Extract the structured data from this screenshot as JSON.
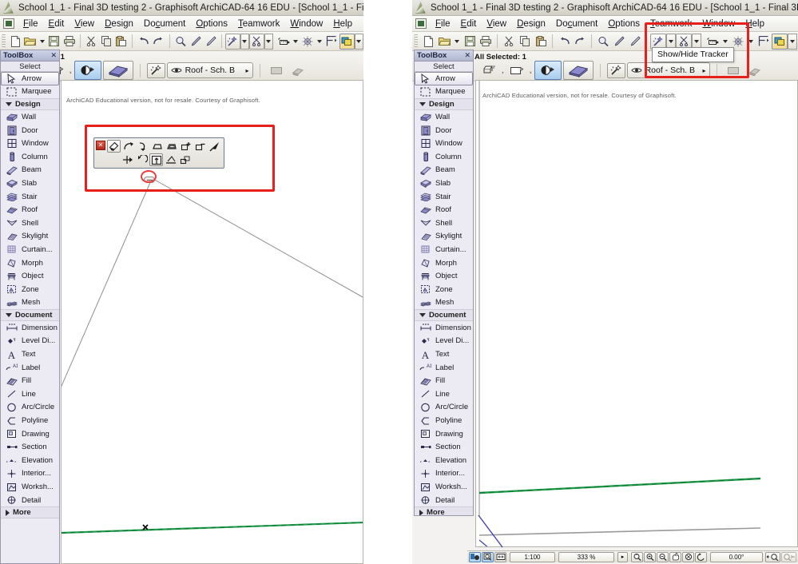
{
  "app": {
    "title": "School 1_1 - Final 3D testing 2 - Graphisoft ArchiCAD-64 16 EDU - [School 1_1 - Final 3D",
    "logo_icon": "archicad-logo-icon"
  },
  "menubar": {
    "items": [
      {
        "label": "File"
      },
      {
        "label": "Edit"
      },
      {
        "label": "View"
      },
      {
        "label": "Design"
      },
      {
        "label": "Document"
      },
      {
        "label": "Options"
      },
      {
        "label": "Teamwork"
      },
      {
        "label": "Window"
      },
      {
        "label": "Help"
      }
    ]
  },
  "toolbar": {
    "buttons": [
      {
        "name": "new-document-icon",
        "tip": "New"
      },
      {
        "name": "open-folder-icon",
        "tip": "Open"
      },
      {
        "name": "open-dropdown-caret-icon",
        "tip": "Open options"
      },
      {
        "name": "save-icon",
        "tip": "Save"
      },
      {
        "name": "print-icon",
        "tip": "Print"
      },
      {
        "name": "cut-scissors-icon",
        "tip": "Cut"
      },
      {
        "name": "copy-icon",
        "tip": "Copy"
      },
      {
        "name": "paste-icon",
        "tip": "Paste"
      },
      {
        "name": "undo-icon",
        "tip": "Undo"
      },
      {
        "name": "redo-icon",
        "tip": "Redo"
      },
      {
        "name": "find-select-icon",
        "tip": "Find & Select"
      },
      {
        "name": "pencil-icon",
        "tip": "Pencil"
      },
      {
        "name": "pencil-alt-icon",
        "tip": "Pencil"
      },
      {
        "name": "magic-wand-icon",
        "tip": "Magic Wand"
      },
      {
        "name": "magic-wand-caret-icon",
        "tip": "Magic Wand options"
      },
      {
        "name": "trim-icon",
        "tip": "Trim"
      },
      {
        "name": "trim-caret-icon",
        "tip": "Trim options"
      },
      {
        "name": "measure-icon",
        "tip": "Measure"
      },
      {
        "name": "measure-caret-icon",
        "tip": "Measure options"
      },
      {
        "name": "grid-snap-icon",
        "tip": "Grid Snap"
      },
      {
        "name": "grid-snap-caret-icon",
        "tip": "Grid Snap options"
      },
      {
        "name": "guide-lines-icon",
        "tip": "Guide Lines"
      },
      {
        "name": "show-hide-tracker-icon",
        "tip": "Show/Hide Tracker"
      },
      {
        "name": "tracker-caret-icon",
        "tip": "Tracker options"
      }
    ]
  },
  "infobar": {
    "close_label": "✕",
    "selected_text": "All Selected: 1",
    "buttons": [
      {
        "name": "settings-dialog-icon"
      },
      {
        "name": "favorites-icon"
      },
      {
        "name": "pen-color-icon"
      },
      {
        "name": "element-preview-icon"
      }
    ],
    "separator_1": ",",
    "separator_2": ",",
    "magic_wand_icon": "magic-wand-icon",
    "layer_combo": {
      "icon": "eye-icon",
      "value": "Roof - Sch. B",
      "arrow": "▸"
    }
  },
  "toolbox": {
    "title": "ToolBox",
    "close_label": "✕",
    "select_header": "Select",
    "groups": [
      {
        "name": "select",
        "kind": "plain",
        "items": [
          {
            "label": "Arrow",
            "icon": "arrow-cursor-icon",
            "selected": true
          },
          {
            "label": "Marquee",
            "icon": "marquee-icon",
            "selected": false
          }
        ]
      },
      {
        "name": "design",
        "kind": "collapsible",
        "label": "Design",
        "expanded": true,
        "items": [
          {
            "label": "Wall",
            "icon": "wall-icon"
          },
          {
            "label": "Door",
            "icon": "door-icon"
          },
          {
            "label": "Window",
            "icon": "window-icon"
          },
          {
            "label": "Column",
            "icon": "column-icon"
          },
          {
            "label": "Beam",
            "icon": "beam-icon"
          },
          {
            "label": "Slab",
            "icon": "slab-icon"
          },
          {
            "label": "Stair",
            "icon": "stair-icon"
          },
          {
            "label": "Roof",
            "icon": "roof-icon"
          },
          {
            "label": "Shell",
            "icon": "shell-icon"
          },
          {
            "label": "Skylight",
            "icon": "skylight-icon"
          },
          {
            "label": "Curtain...",
            "icon": "curtain-wall-icon"
          },
          {
            "label": "Morph",
            "icon": "morph-icon"
          },
          {
            "label": "Object",
            "icon": "object-icon"
          },
          {
            "label": "Zone",
            "icon": "zone-icon"
          },
          {
            "label": "Mesh",
            "icon": "mesh-icon"
          }
        ]
      },
      {
        "name": "document",
        "kind": "collapsible",
        "label": "Document",
        "expanded": true,
        "items": [
          {
            "label": "Dimension",
            "icon": "dimension-icon"
          },
          {
            "label": "Level Di...",
            "icon": "level-dimension-icon"
          },
          {
            "label": "Text",
            "icon": "text-icon"
          },
          {
            "label": "Label",
            "icon": "label-icon"
          },
          {
            "label": "Fill",
            "icon": "fill-icon"
          },
          {
            "label": "Line",
            "icon": "line-icon"
          },
          {
            "label": "Arc/Circle",
            "icon": "arc-circle-icon"
          },
          {
            "label": "Polyline",
            "icon": "polyline-icon"
          },
          {
            "label": "Drawing",
            "icon": "drawing-icon"
          },
          {
            "label": "Section",
            "icon": "section-icon"
          },
          {
            "label": "Elevation",
            "icon": "elevation-icon"
          },
          {
            "label": "Interior...",
            "icon": "interior-elevation-icon"
          },
          {
            "label": "Worksh...",
            "icon": "worksheet-icon"
          },
          {
            "label": "Detail",
            "icon": "detail-icon"
          }
        ]
      },
      {
        "name": "more",
        "kind": "collapsible",
        "label": "More",
        "expanded": false,
        "items": []
      }
    ]
  },
  "canvas": {
    "watermark": "ArchiCAD Educational version, not for resale. Courtesy of Graphisoft.",
    "colors": {
      "green_line": "#1f9e4a",
      "gray_line": "#8e8e8e",
      "blue_line": "#3b3bb0",
      "marker": "#000000"
    }
  },
  "pet_palette": {
    "close_label": "✕",
    "row1": [
      {
        "name": "pet-edit-polygon-icon",
        "active": true
      },
      {
        "name": "pet-curve-edge-icon",
        "active": false
      },
      {
        "name": "pet-curve-tangent-icon",
        "active": false
      },
      {
        "name": "pet-offset-edge-icon",
        "active": false
      },
      {
        "name": "pet-offset-all-edges-icon",
        "active": false
      },
      {
        "name": "pet-add-to-polygon-icon",
        "active": false
      },
      {
        "name": "pet-subtract-from-polygon-icon",
        "active": false
      },
      {
        "name": "pet-insert-node-icon",
        "active": false
      }
    ],
    "row2": [
      {
        "name": "pet-drag-icon",
        "active": false
      },
      {
        "name": "pet-rotate-icon",
        "active": false
      },
      {
        "name": "pet-elevate-icon",
        "active": true
      },
      {
        "name": "pet-pivot-line-icon",
        "active": false
      },
      {
        "name": "pet-multiply-icon",
        "active": false
      }
    ],
    "handle_name": "pet-palette-drag-handle"
  },
  "annotations": {
    "left_redbox_name": "pet-palette-highlight-box",
    "left_redellipse_name": "pet-handle-highlight-ellipse",
    "right_redbox_name": "tracker-button-highlight-box"
  },
  "tooltip": {
    "text": "Show/Hide Tracker"
  },
  "statusbar": {
    "buttons": [
      {
        "name": "3d-view-icon",
        "active": true
      },
      {
        "name": "zoom-selection-icon",
        "active": true
      },
      {
        "name": "fit-in-window-icon",
        "active": false
      }
    ],
    "scale_value": "1:100",
    "zoom_value": "333 %",
    "orientation_value": "0.00°",
    "play_arrow": "▸",
    "nav_buttons": [
      {
        "name": "zoom-marquee-icon"
      },
      {
        "name": "zoom-in-icon"
      },
      {
        "name": "zoom-out-icon"
      },
      {
        "name": "pan-icon"
      },
      {
        "name": "previous-zoom-icon"
      },
      {
        "name": "orbit-icon"
      }
    ],
    "end_buttons": [
      {
        "name": "zoom-previous-icon"
      },
      {
        "name": "zoom-next-icon"
      }
    ]
  }
}
